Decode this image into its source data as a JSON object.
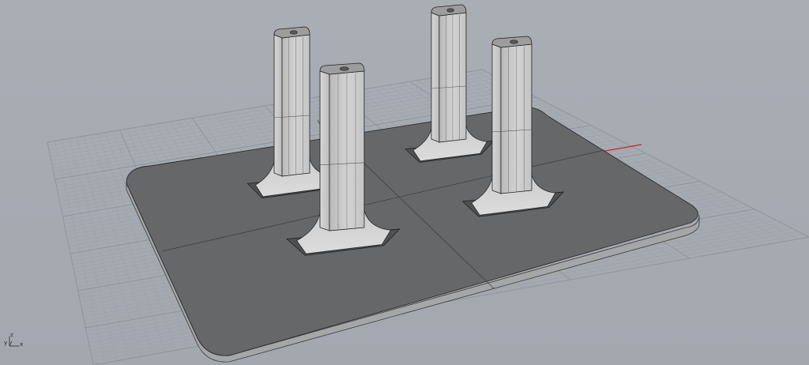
{
  "viewport": {
    "background": "#a7acb3",
    "grid_color": "#9aa0a8",
    "grid_major_color": "#8d939b",
    "x_axis_color": "#c0282a",
    "y_axis_color": "#2e8a3c"
  },
  "axis_gizmo": {
    "x_label": "x",
    "y_label": "y",
    "z_label": "z"
  },
  "model": {
    "plate_top_color": "#656769",
    "plate_edge_color": "#a4a6a8",
    "post_light_color": "#cbcbcb",
    "post_shade_color": "#b0b0b0",
    "post_count": 4
  }
}
